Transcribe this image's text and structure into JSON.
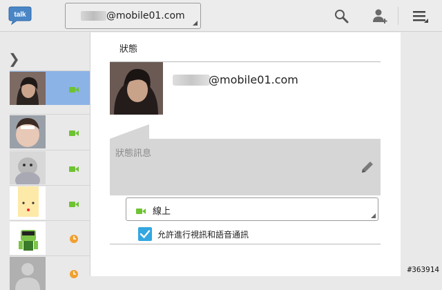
{
  "app": {
    "logo_text": "talk"
  },
  "account": {
    "email_suffix": "@mobile01.com"
  },
  "header_icons": [
    "search-icon",
    "add-contact-icon",
    "menu-icon"
  ],
  "contacts": [
    {
      "status": "video",
      "selected": true
    },
    {
      "status": "video"
    },
    {
      "status": "video"
    },
    {
      "status": "video"
    },
    {
      "status": "away"
    },
    {
      "status": "away"
    }
  ],
  "panel": {
    "section_title": "狀態",
    "email_suffix": "@mobile01.com",
    "status_placeholder": "狀態訊息",
    "presence_label": "線上",
    "allow_label": "允許進行視訊和語音通訊",
    "allow_checked": true
  },
  "watermark": "#363914",
  "colors": {
    "accent_blue": "#33a7e0",
    "video_green": "#6ec332",
    "away_orange": "#f0a030",
    "selected_row": "#8cb3e6"
  }
}
